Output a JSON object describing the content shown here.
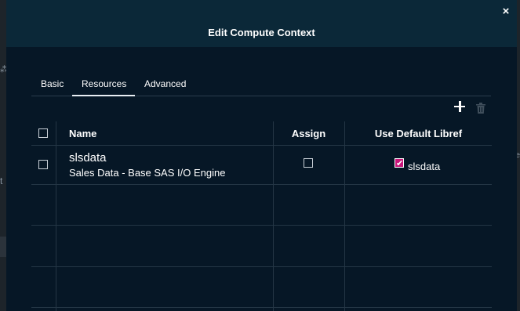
{
  "dialog": {
    "title": "Edit Compute Context",
    "close_glyph": "×"
  },
  "tabs": [
    {
      "label": "Basic",
      "selected": false
    },
    {
      "label": "Resources",
      "selected": true
    },
    {
      "label": "Advanced",
      "selected": false
    }
  ],
  "toolbar": {
    "add_icon": "plus-icon",
    "delete_icon": "trash-icon",
    "delete_enabled": false
  },
  "table": {
    "columns": [
      "Name",
      "Assign",
      "Use Default Libref"
    ],
    "rows": [
      {
        "name": "slsdata",
        "description": "Sales Data - Base SAS I/O Engine",
        "selected": false,
        "assign": false,
        "use_default_libref": true,
        "libref": "slsdata"
      }
    ]
  },
  "colors": {
    "accent_checkbox": "#c8157a",
    "dialog_bg": "#061726",
    "header_bg": "#0b2838"
  }
}
